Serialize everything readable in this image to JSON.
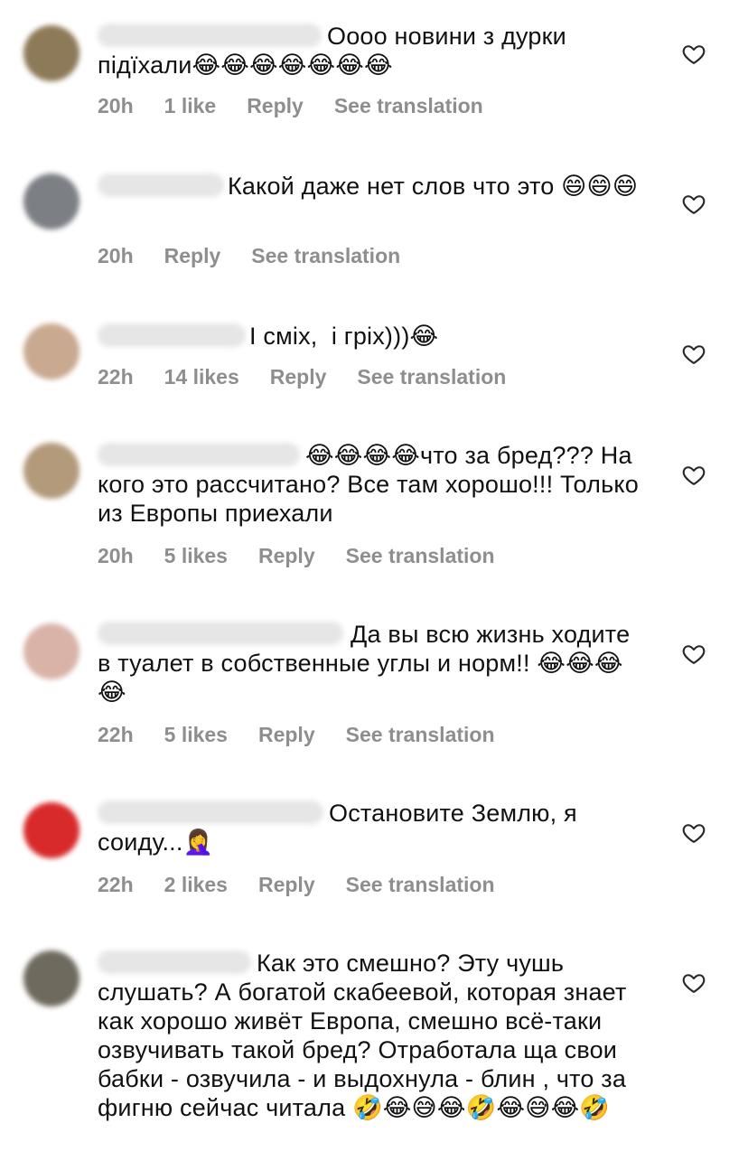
{
  "comments": [
    {
      "text": "Оооо новини з дурки підїхали😂😂😂😂😂😂😂",
      "time": "20h",
      "likes": "1 like",
      "reply": "Reply",
      "translation": "See translation",
      "avatar_color": "#8d7a58"
    },
    {
      "text": "Какой даже нет слов что это 😄😄😄",
      "time": "20h",
      "likes": "",
      "reply": "Reply",
      "translation": "See translation",
      "avatar_color": "#7c7f84"
    },
    {
      "text": "І сміх,  і гріх)))😂",
      "time": "22h",
      "likes": "14 likes",
      "reply": "Reply",
      "translation": "See translation",
      "avatar_color": "#c9a98f"
    },
    {
      "text": "😂😂😂😂что за бред??? На кого это рассчитано? Все там хорошо!!! Только из Европы приехали",
      "time": "20h",
      "likes": "5 likes",
      "reply": "Reply",
      "translation": "See translation",
      "avatar_color": "#b39a7a"
    },
    {
      "text": "Да вы всю жизнь ходите в туалет в собственные углы и норм!! 😂😂😂😂",
      "time": "22h",
      "likes": "5 likes",
      "reply": "Reply",
      "translation": "See translation",
      "avatar_color": "#d9b3a8"
    },
    {
      "text": "Остановите Землю, я соиду...🤦‍♀️",
      "time": "22h",
      "likes": "2 likes",
      "reply": "Reply",
      "translation": "See translation",
      "avatar_color": "#d82a2a"
    },
    {
      "text": "Как это смешно? Эту чушь слушать? А богатой скабеевой, которая знает как хорошо живёт Европа, смешно всё-таки озвучивать такой бред? Отработала ща свои бабки - озвучила - и выдохнула - блин , что за фигню сейчас читала 🤣😂😅😂🤣😂😅😂🤣",
      "time": "",
      "likes": "",
      "reply": "",
      "translation": "",
      "avatar_color": "#6f6a5e"
    }
  ],
  "icons": {
    "like": "heart-outline-icon"
  }
}
